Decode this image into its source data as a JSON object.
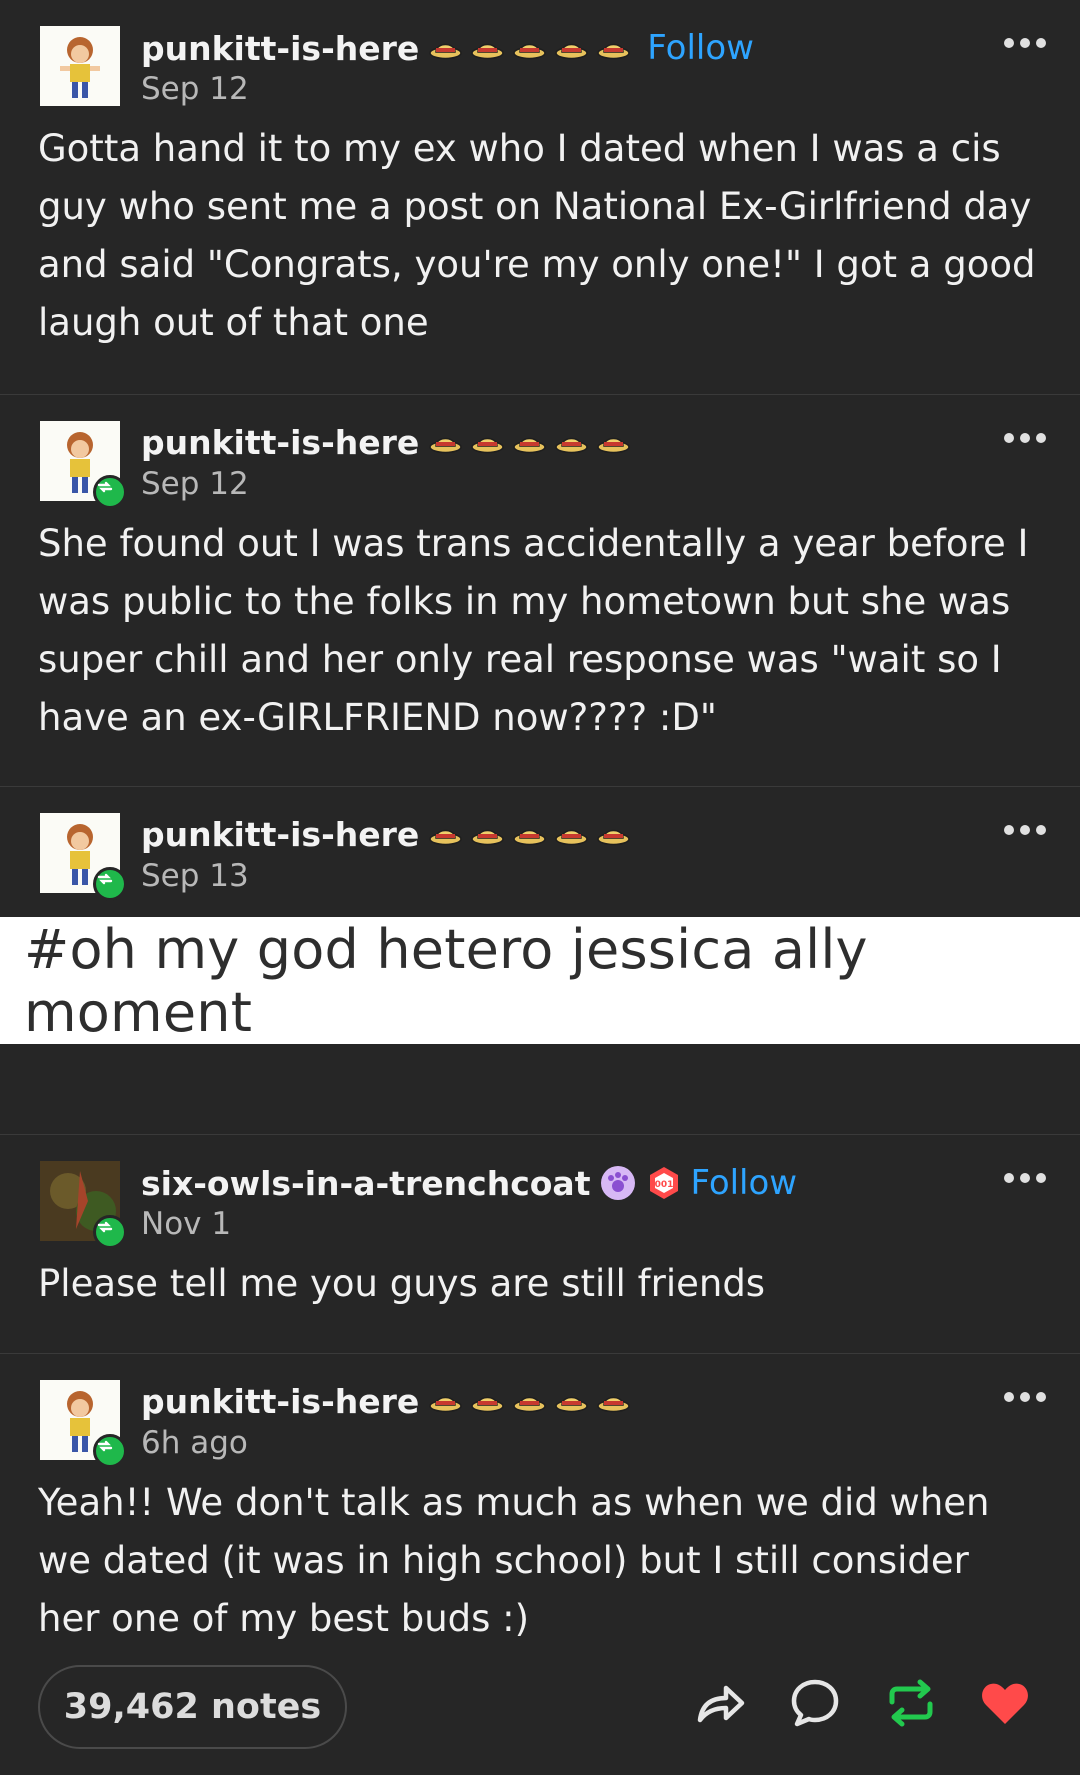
{
  "posts": [
    {
      "username": "punkitt-is-here",
      "follow": "Follow",
      "date": "Sep 12",
      "text": "Gotta hand it to my ex who I dated when I was a cis guy who sent me a post on National Ex-Girlfriend day and said \"Congrats, you're my only one!\" I got a good laugh out of that one"
    },
    {
      "username": "punkitt-is-here",
      "date": "Sep 12",
      "text": "She found out I was trans accidentally a year before I was public to the folks in my hometown but she was super chill and her only real response was \"wait so I have an ex-GIRLFRIEND now???? :D\""
    },
    {
      "username": "punkitt-is-here",
      "date": "Sep 13",
      "tag": "#oh my god hetero jessica ally moment"
    },
    {
      "username": "six-owls-in-a-trenchcoat",
      "follow": "Follow",
      "date": "Nov 1",
      "text": "Please tell me you guys are still friends"
    },
    {
      "username": "punkitt-is-here",
      "date": "6h ago",
      "text": "Yeah!! We don't talk as much as when we did when we dated (it was in high school) but I still consider her one of my best buds :)"
    }
  ],
  "footer": {
    "notes": "39,462 notes",
    "icons": [
      "share-icon",
      "reply-icon",
      "reblog-icon",
      "like-icon"
    ]
  },
  "colors": {
    "background": "#262626",
    "follow": "#2ea4ff",
    "reblog": "#1fb84b",
    "like": "#ff4a4a"
  }
}
